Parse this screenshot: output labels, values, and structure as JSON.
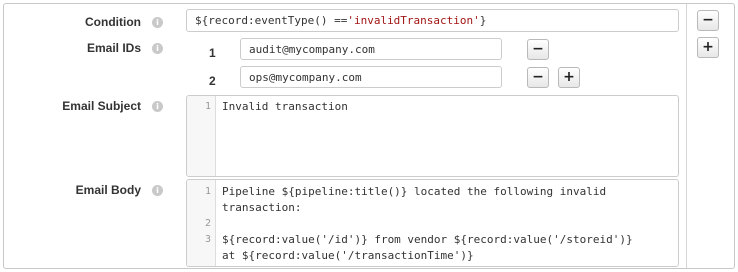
{
  "condition": {
    "label": "Condition",
    "value_prefix": "${record:eventType() == ",
    "value_string": "'invalidTransaction'",
    "value_suffix": "}"
  },
  "email_ids": {
    "label": "Email IDs",
    "items": [
      {
        "index": "1",
        "value": "audit@mycompany.com"
      },
      {
        "index": "2",
        "value": "ops@mycompany.com"
      }
    ]
  },
  "email_subject": {
    "label": "Email Subject",
    "lines": [
      {
        "num": "1",
        "text": "Invalid transaction"
      }
    ]
  },
  "email_body": {
    "label": "Email Body",
    "lines": [
      {
        "num": "1",
        "text": "Pipeline ${pipeline:title()} located the following invalid"
      },
      {
        "num": "",
        "text": "transaction:"
      },
      {
        "num": "2",
        "text": ""
      },
      {
        "num": "3",
        "text": "${record:value('/id')} from vendor ${record:value('/storeid')}"
      },
      {
        "num": "",
        "text": "at ${record:value('/transactionTime')}"
      }
    ]
  },
  "icons": {
    "info": "i",
    "remove": "−",
    "add": "+"
  },
  "colors": {
    "string_literal": "#a31515",
    "border": "#cccccc"
  }
}
